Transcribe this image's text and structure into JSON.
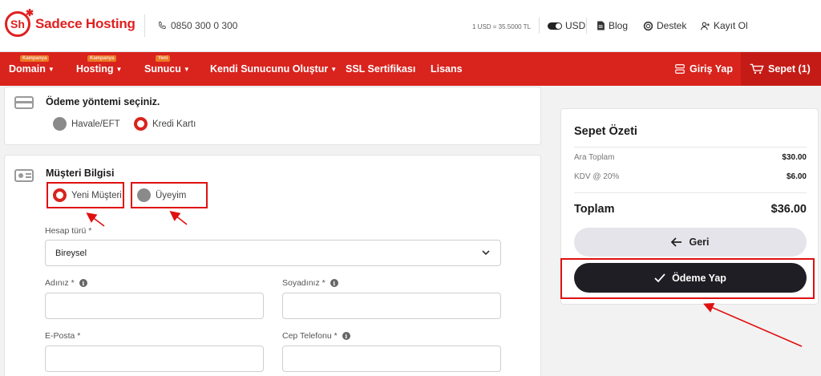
{
  "brand": {
    "logo_mark": "Sh",
    "name": "Sadece Hosting"
  },
  "topbar": {
    "phone": "0850 300 0 300",
    "rate": "1 USD = 35.5000 TL",
    "currency": "USD",
    "blog": "Blog",
    "support": "Destek",
    "signup": "Kayıt Ol"
  },
  "nav": {
    "items": [
      {
        "label": "Domain",
        "badge": "Kampanya"
      },
      {
        "label": "Hosting",
        "badge": "Kampanya"
      },
      {
        "label": "Sunucu",
        "badge": "Yeni"
      },
      {
        "label": "Kendi Sunucunu Oluştur"
      },
      {
        "label": "SSL Sertifikası"
      },
      {
        "label": "Lisans"
      }
    ],
    "login": "Giriş Yap",
    "cart": "Sepet (1)"
  },
  "payment": {
    "title": "Ödeme yöntemi seçiniz.",
    "options": [
      "Havale/EFT",
      "Kredi Kartı"
    ],
    "selected": "Kredi Kartı"
  },
  "customer": {
    "title": "Müşteri Bilgisi",
    "options": [
      "Yeni Müşteri",
      "Üyeyim"
    ],
    "selected": "Yeni Müşteri",
    "account_type_label": "Hesap türü *",
    "account_type_value": "Bireysel",
    "first_name_label": "Adınız *",
    "last_name_label": "Soyadınız *",
    "email_label": "E-Posta *",
    "phone_label": "Cep Telefonu *"
  },
  "summary": {
    "title": "Sepet Özeti",
    "subtotal_label": "Ara Toplam",
    "subtotal_value": "$30.00",
    "tax_label": "KDV @ 20%",
    "tax_value": "$6.00",
    "total_label": "Toplam",
    "total_value": "$36.00",
    "back_label": "Geri",
    "pay_label": "Ödeme Yap"
  },
  "colors": {
    "brand_red": "#d9231d",
    "annotation_red": "#e01010",
    "dark_button": "#1e1e24"
  }
}
